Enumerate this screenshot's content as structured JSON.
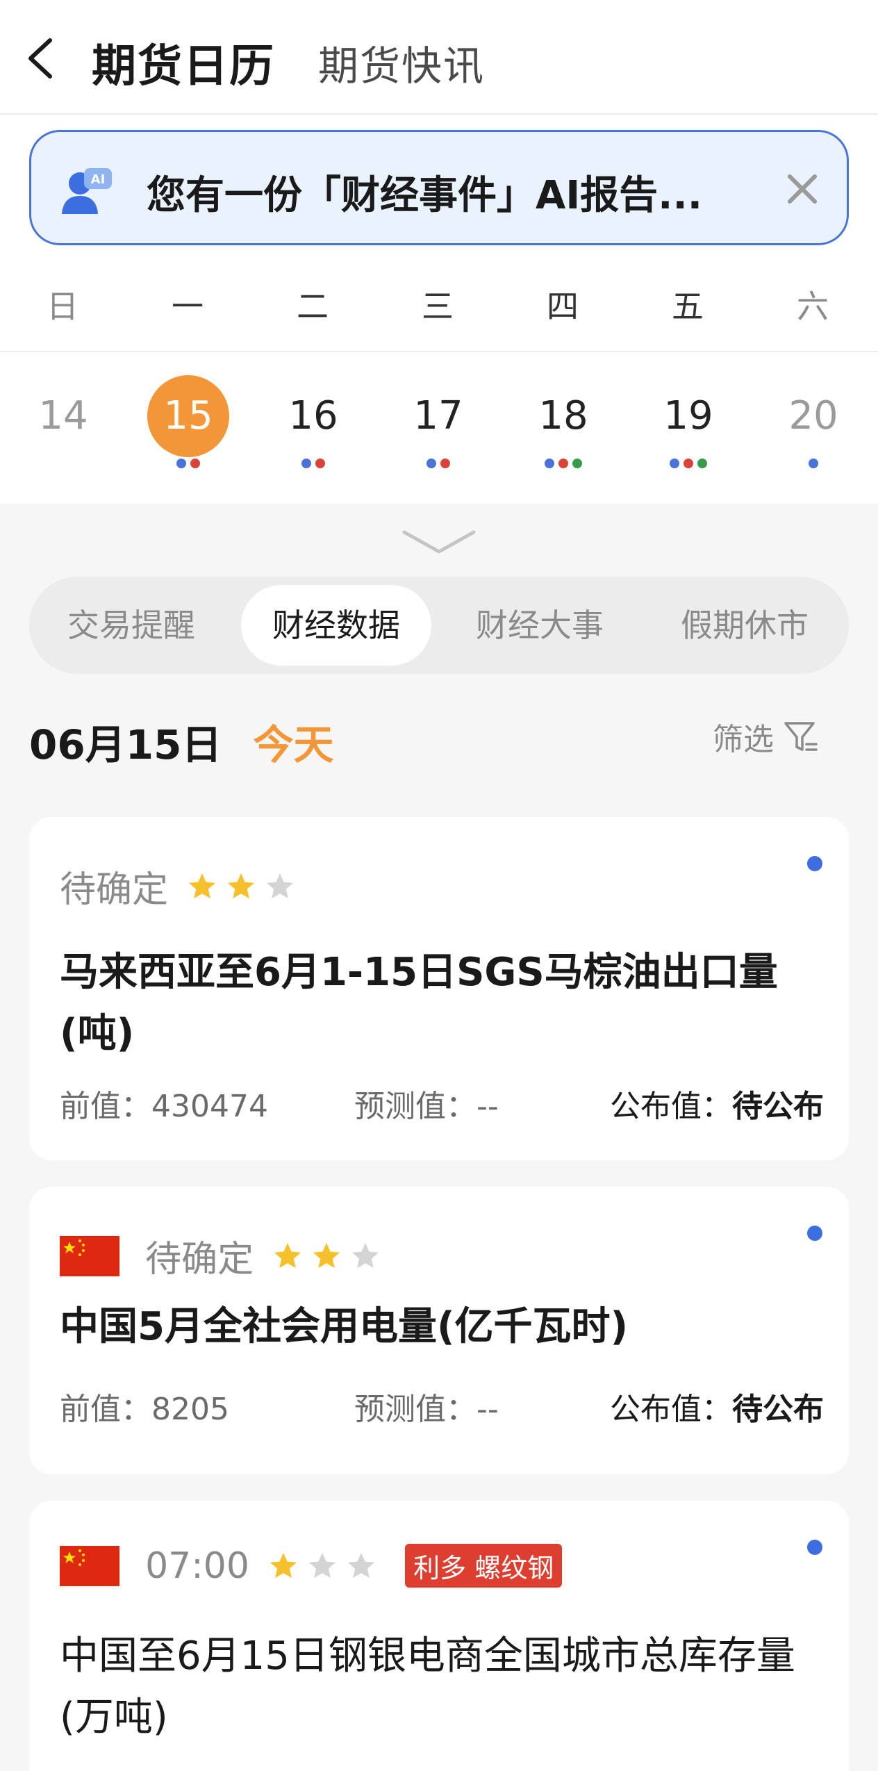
{
  "header": {
    "title": "期货日历",
    "subtitle": "期货快讯"
  },
  "ai_banner": {
    "text": "您有一份「财经事件」AI报告..."
  },
  "calendar": {
    "weekdays": [
      "日",
      "一",
      "二",
      "三",
      "四",
      "五",
      "六"
    ],
    "dates": [
      {
        "day": "14",
        "dots": []
      },
      {
        "day": "15",
        "dots": [
          "#4a73d8",
          "#d9443a"
        ]
      },
      {
        "day": "16",
        "dots": [
          "#4a73d8",
          "#d9443a"
        ]
      },
      {
        "day": "17",
        "dots": [
          "#4a73d8",
          "#d9443a"
        ]
      },
      {
        "day": "18",
        "dots": [
          "#4a73d8",
          "#d9443a",
          "#3a9a4c"
        ]
      },
      {
        "day": "19",
        "dots": [
          "#4a73d8",
          "#d9443a",
          "#3a9a4c"
        ]
      },
      {
        "day": "20",
        "dots": [
          "#4a73d8"
        ]
      }
    ],
    "selected_index": 1
  },
  "tabs": [
    {
      "label": "交易提醒"
    },
    {
      "label": "财经数据"
    },
    {
      "label": "财经大事"
    },
    {
      "label": "假期休市"
    }
  ],
  "active_tab": 1,
  "day_header": {
    "date": "06月15日",
    "today_label": "今天",
    "filter_label": "筛选"
  },
  "cards": [
    {
      "time": "待确定",
      "stars": 2,
      "title": "马来西亚至6月1-15日SGS马棕油出口量(吨)",
      "prev_label": "前值：",
      "prev_value": "430474",
      "forecast_label": "预测值：",
      "forecast_value": "--",
      "actual_label": "公布值：",
      "actual_value": "待公布"
    },
    {
      "time": "待确定",
      "stars": 2,
      "title": "中国5月全社会用电量(亿千瓦时)",
      "prev_label": "前值：",
      "prev_value": "8205",
      "forecast_label": "预测值：",
      "forecast_value": "--",
      "actual_label": "公布值：",
      "actual_value": "待公布"
    },
    {
      "time": "07:00",
      "stars": 1,
      "tag": "利多 螺纹钢",
      "title": "中国至6月15日钢银电商全国城市总库存量(万吨)"
    }
  ],
  "colors": {
    "accent_orange": "#f39637",
    "banner_border": "#4a75d6",
    "star_on": "#f6c02c",
    "star_off": "#d4d4d4",
    "tag_red": "#dd3e30",
    "dot_blue": "#3d6ee0"
  }
}
